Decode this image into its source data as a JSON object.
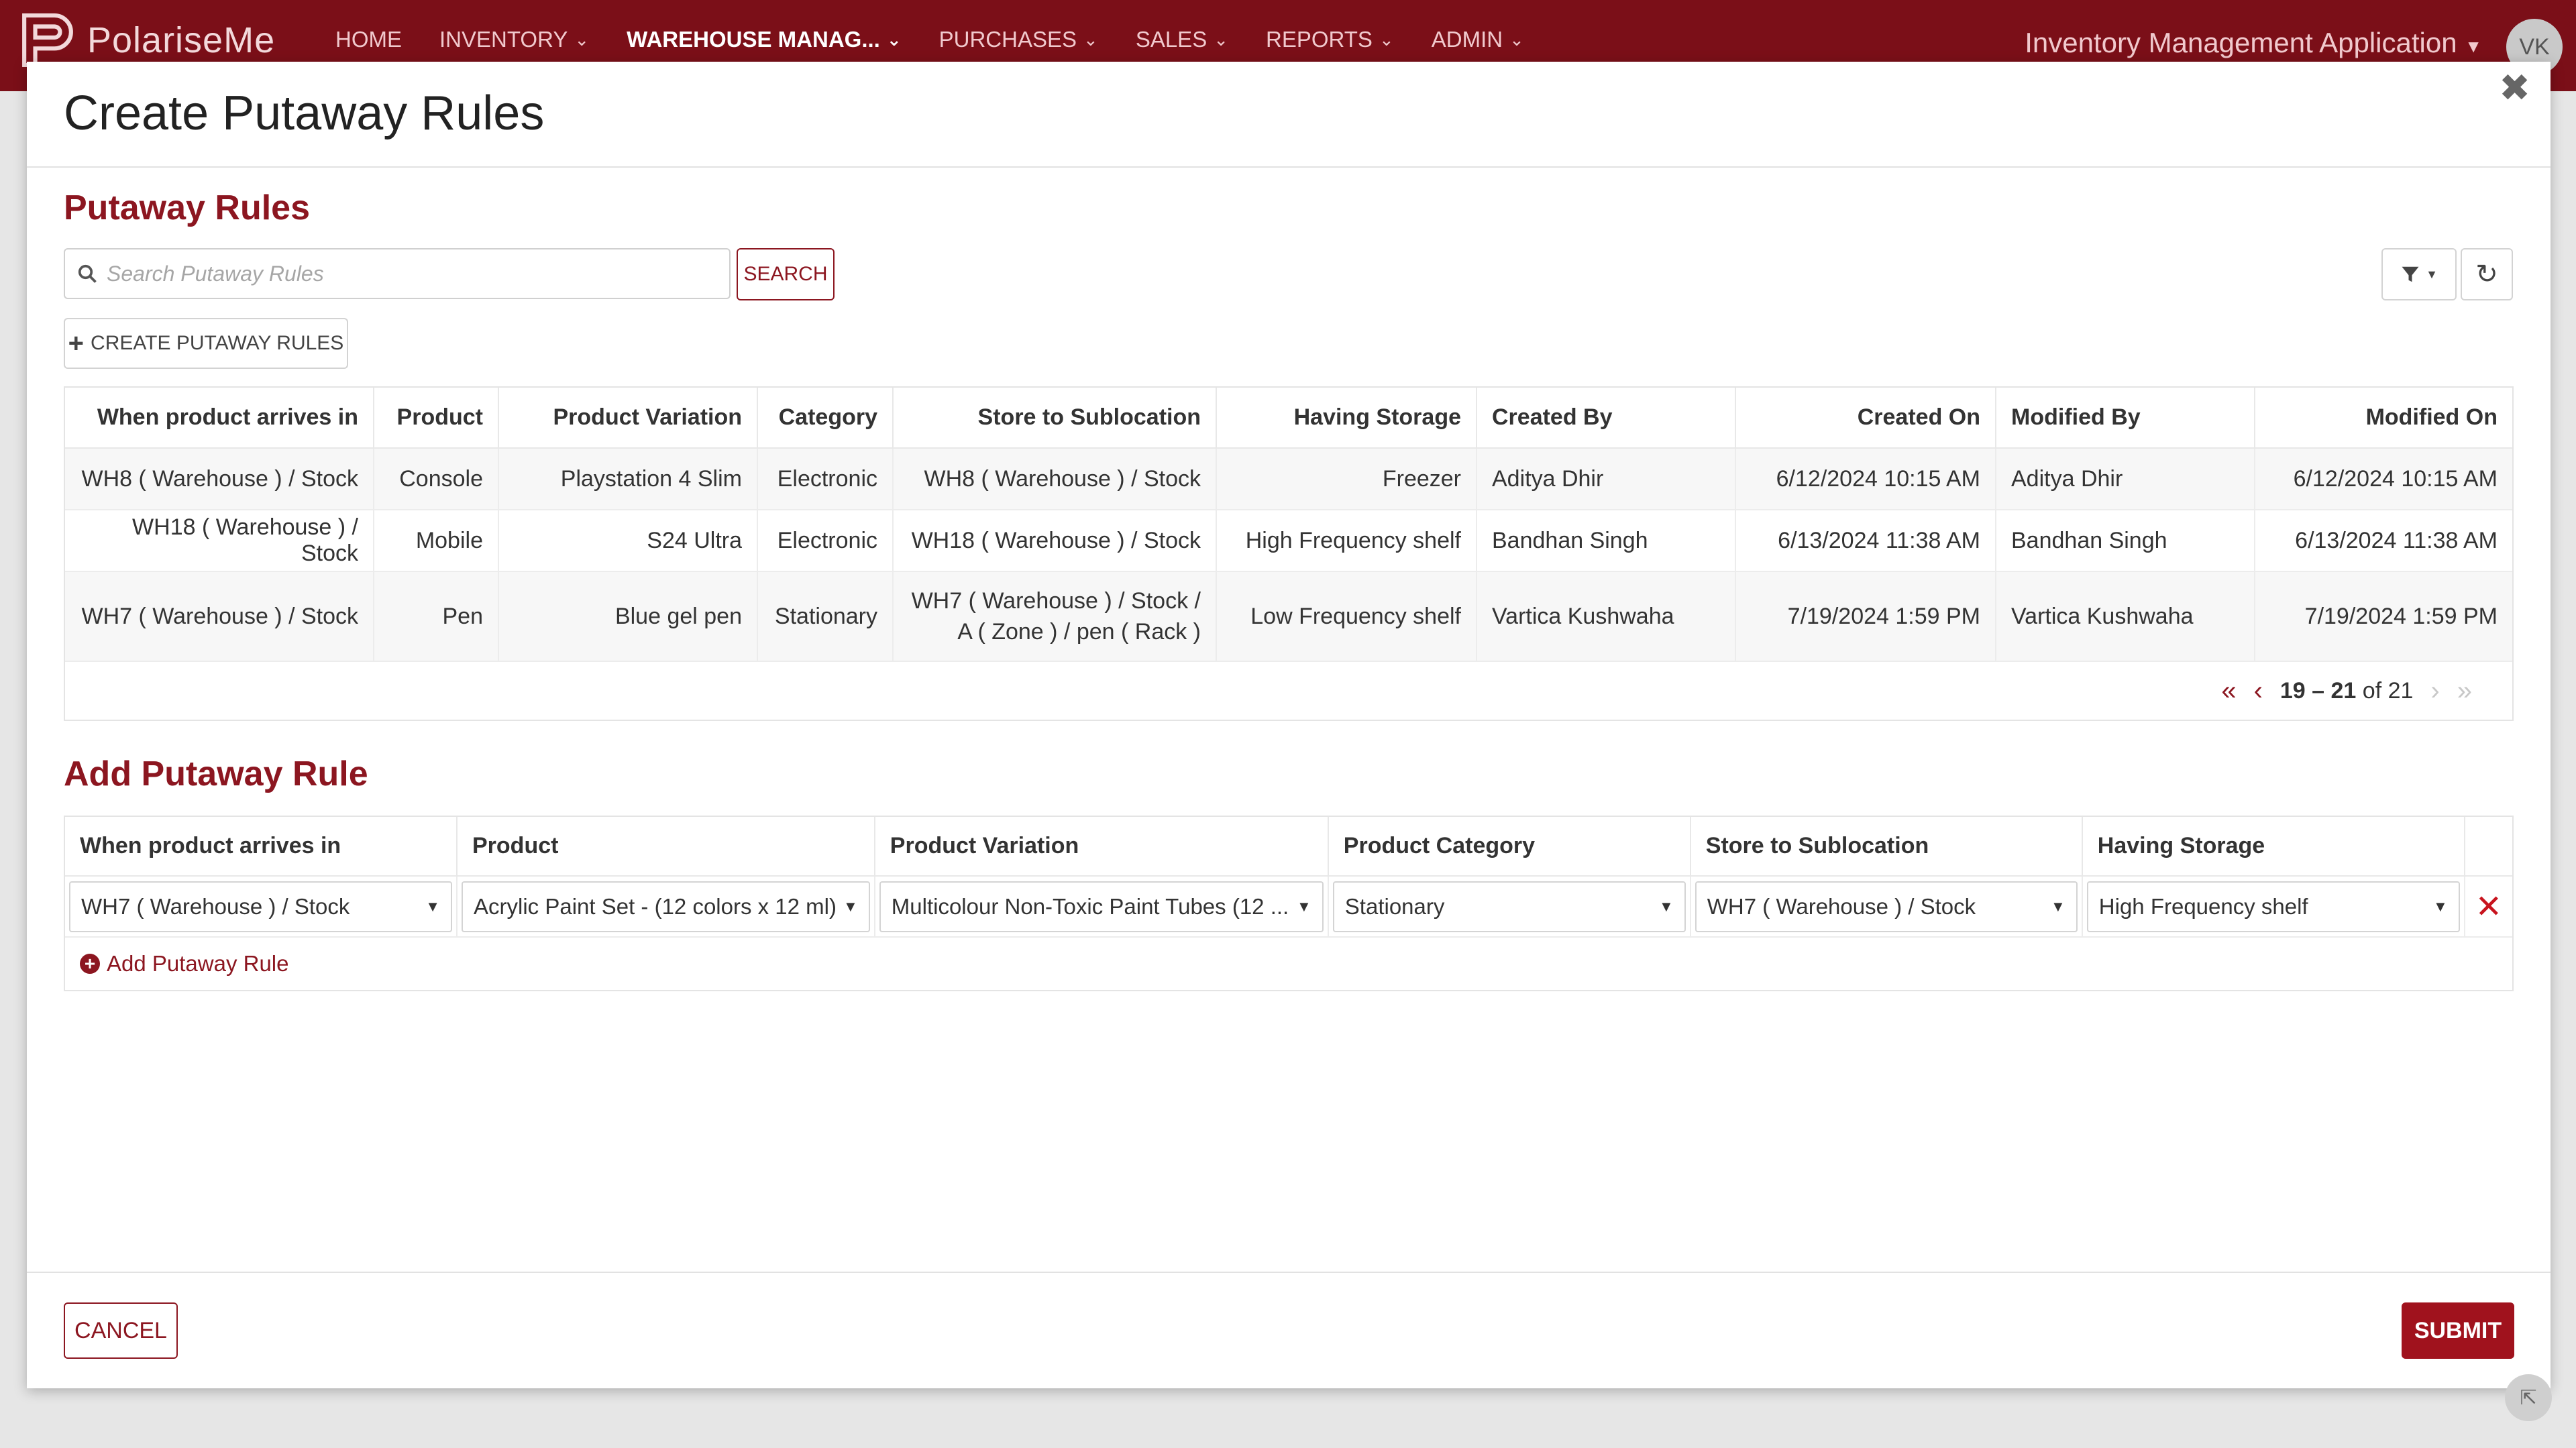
{
  "header": {
    "brand": "PolariseMe",
    "nav": [
      {
        "label": "HOME",
        "dropdown": false,
        "active": false
      },
      {
        "label": "INVENTORY",
        "dropdown": true,
        "active": false
      },
      {
        "label": "WAREHOUSE MANAG...",
        "dropdown": true,
        "active": true
      },
      {
        "label": "PURCHASES",
        "dropdown": true,
        "active": false
      },
      {
        "label": "SALES",
        "dropdown": true,
        "active": false
      },
      {
        "label": "REPORTS",
        "dropdown": true,
        "active": false
      },
      {
        "label": "ADMIN",
        "dropdown": true,
        "active": false
      }
    ],
    "app_title": "Inventory Management Application",
    "avatar_initials": "VK"
  },
  "modal": {
    "title": "Create Putaway Rules",
    "rules_section_title": "Putaway Rules",
    "search_placeholder": "Search Putaway Rules",
    "search_button": "SEARCH",
    "create_button": "CREATE PUTAWAY RULES",
    "table": {
      "columns": [
        "When product arrives in",
        "Product",
        "Product Variation",
        "Category",
        "Store to Sublocation",
        "Having Storage",
        "Created By",
        "Created On",
        "Modified By",
        "Modified On"
      ],
      "rows": [
        [
          "WH8 ( Warehouse ) / Stock",
          "Console",
          "Playstation 4 Slim",
          "Electronic",
          "WH8 ( Warehouse ) / Stock",
          "Freezer",
          "Aditya Dhir",
          "6/12/2024 10:15 AM",
          "Aditya Dhir",
          "6/12/2024 10:15 AM"
        ],
        [
          "WH18 ( Warehouse ) / Stock",
          "Mobile",
          "S24 Ultra",
          "Electronic",
          "WH18 ( Warehouse ) / Stock",
          "High Frequency shelf",
          "Bandhan Singh",
          "6/13/2024 11:38 AM",
          "Bandhan Singh",
          "6/13/2024 11:38 AM"
        ],
        [
          "WH7 ( Warehouse ) / Stock",
          "Pen",
          "Blue gel pen",
          "Stationary",
          "WH7 ( Warehouse ) / Stock / A ( Zone ) / pen ( Rack )",
          "Low Frequency shelf",
          "Vartica Kushwaha",
          "7/19/2024 1:59 PM",
          "Vartica Kushwaha",
          "7/19/2024 1:59 PM"
        ]
      ]
    },
    "pager": {
      "range": "19 – 21",
      "of_label": "of 21"
    },
    "add_section_title": "Add Putaway Rule",
    "add_table": {
      "columns": [
        "When product arrives in",
        "Product",
        "Product Variation",
        "Product Category",
        "Store to Sublocation",
        "Having Storage"
      ],
      "row": [
        "WH7 ( Warehouse ) / Stock",
        "Acrylic Paint Set - (12 colors x 12 ml)",
        "Multicolour Non-Toxic Paint Tubes (12 ...",
        "Stationary",
        "WH7 ( Warehouse ) / Stock",
        "High Frequency shelf"
      ]
    },
    "add_rule_link": "Add Putaway Rule",
    "cancel_button": "CANCEL",
    "submit_button": "SUBMIT"
  },
  "colors": {
    "brand": "#7b0f18",
    "accent": "#8c1620",
    "danger": "#c8141e"
  }
}
